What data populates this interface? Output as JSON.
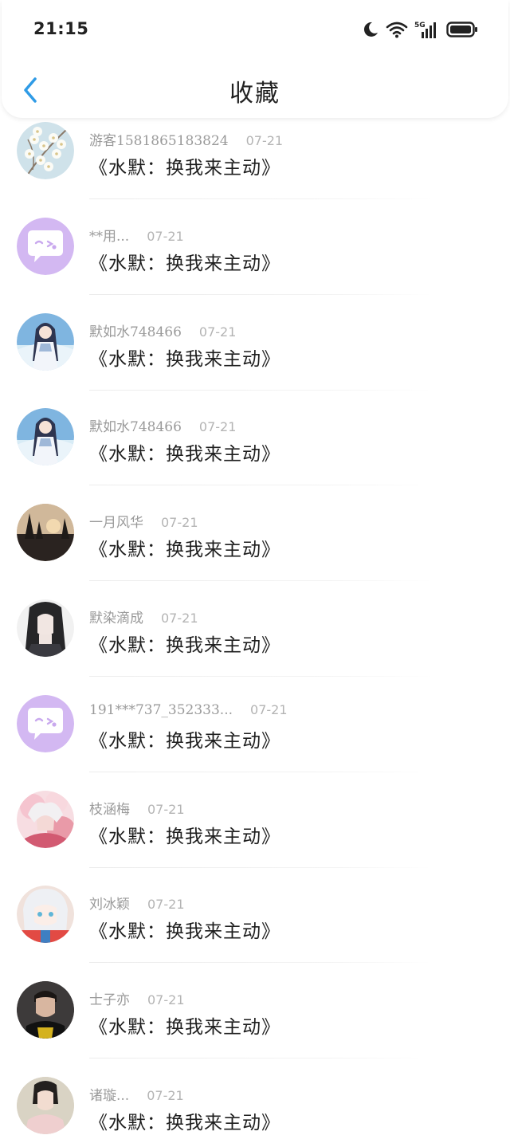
{
  "status_bar": {
    "time": "21:15",
    "network": "5G"
  },
  "header": {
    "title": "收藏"
  },
  "items": [
    {
      "user": "游客1581865183824",
      "date": "07-21",
      "title": "《水默：换我来主动》",
      "avatar": "blossom"
    },
    {
      "user": "**用...",
      "date": "07-21",
      "title": "《水默：换我来主动》",
      "avatar": "chat-bubble"
    },
    {
      "user": "默如水748466",
      "date": "07-21",
      "title": "《水默：换我来主动》",
      "avatar": "anime-girl-sky"
    },
    {
      "user": "默如水748466",
      "date": "07-21",
      "title": "《水默：换我来主动》",
      "avatar": "anime-girl-sky"
    },
    {
      "user": "一月风华",
      "date": "07-21",
      "title": "《水默：换我来主动》",
      "avatar": "sunset-trees"
    },
    {
      "user": "默染滴成",
      "date": "07-21",
      "title": "《水默：换我来主动》",
      "avatar": "dark-hair-girl"
    },
    {
      "user": "191***737_352333...",
      "date": "07-21",
      "title": "《水默：换我来主动》",
      "avatar": "chat-bubble"
    },
    {
      "user": "枝涵梅",
      "date": "07-21",
      "title": "《水默：换我来主动》",
      "avatar": "pink-anime"
    },
    {
      "user": "刘冰颖",
      "date": "07-21",
      "title": "《水默：换我来主动》",
      "avatar": "white-hair-anime"
    },
    {
      "user": "士子亦",
      "date": "07-21",
      "title": "《水默：换我来主动》",
      "avatar": "young-man"
    },
    {
      "user": "诸璇...",
      "date": "07-21",
      "title": "《水默：换我来主动》",
      "avatar": "costume-girl"
    }
  ],
  "colors": {
    "accent": "#2f9be6",
    "chat_avatar_bg": "#d3b8f2"
  }
}
